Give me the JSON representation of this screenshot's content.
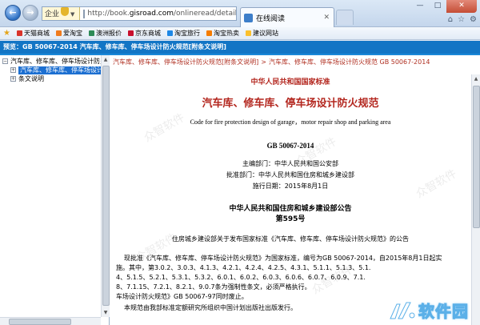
{
  "browser": {
    "zone_label": "企业",
    "url_prefix": "http://book.",
    "url_domain": "gisroad.com",
    "url_path": "/onlineread/detail.aspx",
    "tab_title": "在线阅读"
  },
  "favorites": [
    "天猫商城",
    "爱淘宝",
    "澳洲报价",
    "京东商城",
    "淘宝旅行",
    "淘宝热卖",
    "建议网站"
  ],
  "header": {
    "title": "预览：GB 50067-2014 汽车库、修车库、停车场设计防火规范[附条文说明]"
  },
  "tree": {
    "nodes": [
      {
        "label": "汽车库、修车库、停车场设计防火规"
      },
      {
        "label": "汽车库、修车库、停车场设计防"
      },
      {
        "label": "条文说明"
      }
    ]
  },
  "breadcrumb": {
    "first": "汽车库、修车库、停车场设计防火规范[附条文说明]",
    "second": "汽车库、修车库、停车场设计防火规范 GB 50067-2014"
  },
  "doc": {
    "authority": "中华人民共和国国家标准",
    "title": "汽车库、修车库、停车场设计防火规范",
    "english": "Code for fire protection design of garage，motor repair shop and parking area",
    "code": "GB 50067-2014",
    "chief_dept": "主编部门：中华人民共和国公安部",
    "approve_dept": "批准部门：中华人民共和国住房和城乡建设部",
    "effective": "施行日期：2015年8月1日",
    "ministry": "中华人民共和国住房和城乡建设部公告",
    "notice_no": "第595号",
    "notice_subject": "住房城乡建设部关于发布国家标准《汽车库、修车库、停车场设计防火规范》的公告",
    "para1": [
      "现批准《汽车库、修车库、停车场设计防火规范》为国家标准，编号为GB 50067-2014，自2015年8月1日起实",
      "施。其中，第3.0.2、3.0.3、4.1.3、4.2.1、4.2.4、4.2.5、4.3.1、5.1.1、5.1.3、5.1.",
      "4、5.1.5、5.2.1、5.3.1、5.3.2、6.0.1、6.0.2、6.0.3、6.0.6、6.0.7、6.0.9、7.1.",
      "8、7.1.15、7.2.1、8.2.1、9.0.7条为强制性条文，必须严格执行。",
      "车场设计防火规范》GB 50067-97同时废止。"
    ],
    "para2": "本规范由我部标准定额研究所组织中国计划出版社出版发行。"
  },
  "watermark_text": "众智软件",
  "logo_text": "软件园"
}
